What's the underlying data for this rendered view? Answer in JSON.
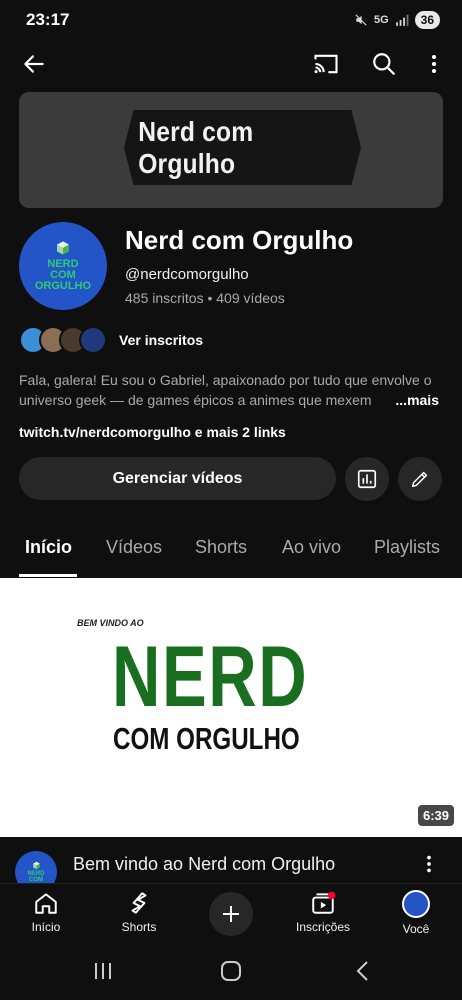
{
  "status_bar": {
    "time": "23:17",
    "network": "5G",
    "battery": "36"
  },
  "banner": {
    "text": "Nerd com Orgulho"
  },
  "avatar": {
    "line1": "NERD",
    "line2": "COM",
    "line3": "ORGULHO"
  },
  "channel": {
    "name": "Nerd com Orgulho",
    "handle": "@nerdcomorgulho",
    "stats": "485 inscritos • 409 vídeos"
  },
  "subscribers": {
    "label": "Ver inscritos"
  },
  "description": {
    "line1": "Fala, galera! Eu sou o Gabriel, apaixonado por tudo que envolve o",
    "line2": "universo geek — de games épicos a animes que mexem",
    "more": "...mais"
  },
  "links": {
    "text": "twitch.tv/nerdcomorgulho e mais 2 links"
  },
  "actions": {
    "manage_label": "Gerenciar vídeos"
  },
  "tabs": [
    {
      "label": "Início"
    },
    {
      "label": "Vídeos"
    },
    {
      "label": "Shorts"
    },
    {
      "label": "Ao vivo"
    },
    {
      "label": "Playlists"
    }
  ],
  "video": {
    "thumb_small": "BEM VINDO AO",
    "thumb_big": "NERD",
    "thumb_sub": "COM ORGULHO",
    "duration": "6:39",
    "title": "Bem vindo ao Nerd com Orgulho"
  },
  "bottom_nav": [
    {
      "label": "Início"
    },
    {
      "label": "Shorts"
    },
    {
      "label": "Inscrições"
    },
    {
      "label": "Você"
    }
  ],
  "colors": {
    "background": "#0f0f0f",
    "surface": "#272727",
    "brand_green": "#1a6e1f",
    "avatar_blue": "#2354c8",
    "notification_red": "#ff0033"
  }
}
